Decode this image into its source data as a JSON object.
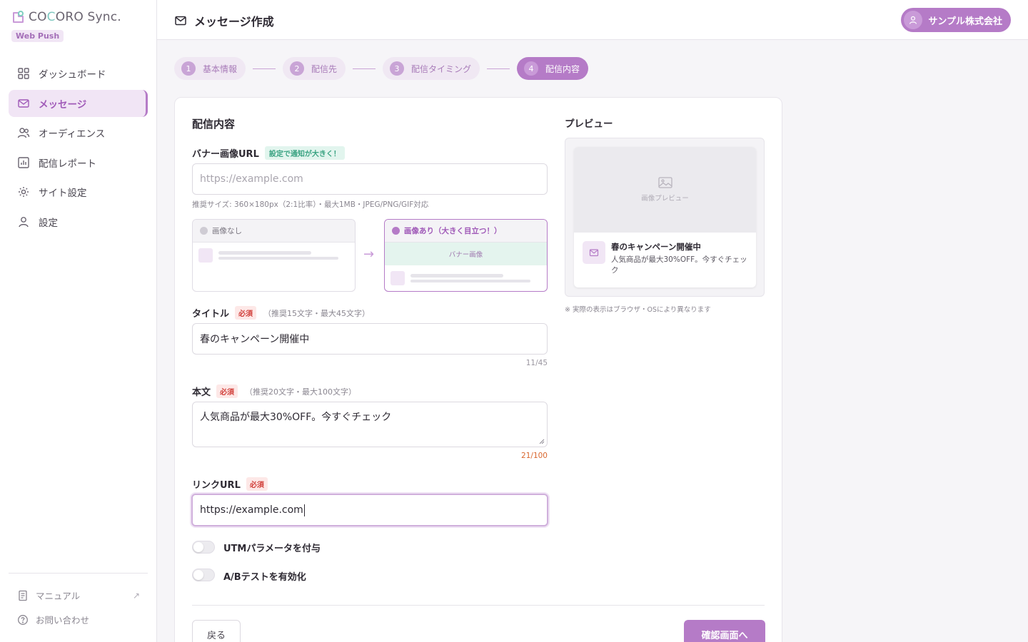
{
  "brand": {
    "name_a": "CO",
    "name_b": "C",
    "name_c": "ORO Sync.",
    "badge": "Web Push"
  },
  "nav": [
    {
      "label": "ダッシュボード",
      "icon": "grid-icon"
    },
    {
      "label": "メッセージ",
      "icon": "mail-icon"
    },
    {
      "label": "オーディエンス",
      "icon": "users-icon"
    },
    {
      "label": "配信レポート",
      "icon": "chart-icon"
    },
    {
      "label": "サイト設定",
      "icon": "gear-icon"
    },
    {
      "label": "設定",
      "icon": "user-icon"
    }
  ],
  "footer": {
    "manual": "マニュアル",
    "contact": "お問い合わせ"
  },
  "header": {
    "title": "メッセージ作成",
    "account": "サンプル株式会社"
  },
  "steps": [
    {
      "num": "1",
      "label": "基本情報"
    },
    {
      "num": "2",
      "label": "配信先"
    },
    {
      "num": "3",
      "label": "配信タイミング"
    },
    {
      "num": "4",
      "label": "配信内容"
    }
  ],
  "form": {
    "section_title": "配信内容",
    "banner": {
      "label": "バナー画像URL",
      "tag": "設定で通知が大きく！",
      "placeholder": "https://example.com",
      "help": "推奨サイズ: 360×180px（2:1比率）・最大1MB・JPEG/PNG/GIF対応",
      "option_none": "画像なし",
      "option_with": "画像あり（大きく目立つ！）",
      "banner_text": "バナー画像"
    },
    "title": {
      "label": "タイトル",
      "required": "必須",
      "hint": "（推奨15文字・最大45文字）",
      "value": "春のキャンペーン開催中",
      "counter": "11/45"
    },
    "body": {
      "label": "本文",
      "required": "必須",
      "hint": "（推奨20文字・最大100文字）",
      "value": "人気商品が最大30%OFF。今すぐチェック",
      "counter": "21/100"
    },
    "link": {
      "label": "リンクURL",
      "required": "必須",
      "value": "https://example.com"
    },
    "utm_label": "UTMパラメータを付与",
    "ab_label": "A/Bテストを有効化",
    "utm_on": false,
    "ab_on": false,
    "back_button": "戻る",
    "next_button": "確認画面へ"
  },
  "preview": {
    "title": "プレビュー",
    "image_placeholder": "画像プレビュー",
    "notif_title": "春のキャンペーン開催中",
    "notif_body": "人気商品が最大30%OFF。今すぐチェック",
    "note": "※ 実際の表示はブラウザ・OSにより異なります"
  },
  "colors": {
    "accent": "#b57bc7",
    "accent_light": "#f1e5f5",
    "required": "#d2423d",
    "counter_warn": "#d9662e"
  }
}
